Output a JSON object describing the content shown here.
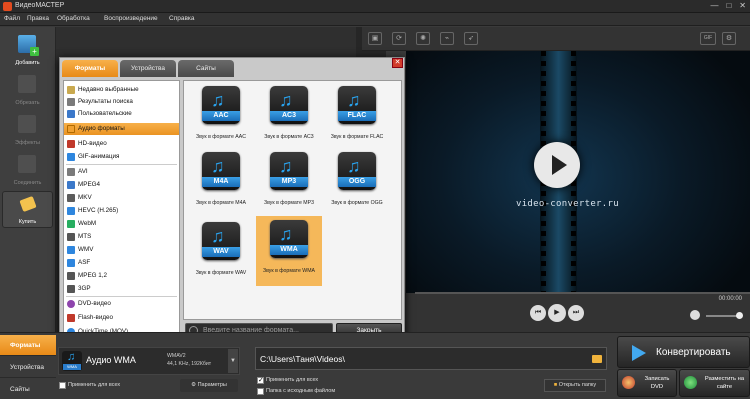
{
  "window": {
    "title": "ВидеоМАСТЕР",
    "controls": [
      "—",
      "□",
      "✕"
    ]
  },
  "menu": [
    "Файл",
    "Правка",
    "Обработка",
    "Воспроизведение",
    "Справка"
  ],
  "sidebar": [
    {
      "label": "Добавить",
      "icon": "add-video-icon",
      "enabled": true
    },
    {
      "label": "Обрезать",
      "icon": "cut-icon",
      "enabled": false
    },
    {
      "label": "Эффекты",
      "icon": "effects-icon",
      "enabled": false
    },
    {
      "label": "Соединить",
      "icon": "join-icon",
      "enabled": false
    },
    {
      "label": "Купить",
      "icon": "buy-icon",
      "enabled": true
    }
  ],
  "dialog": {
    "tabs": [
      "Форматы",
      "Устройства",
      "Сайты"
    ],
    "active_tab": "Форматы",
    "close": "✕",
    "categories": [
      {
        "label": "Недавно выбранные",
        "color": "#c9a94f"
      },
      {
        "label": "Результаты поиска",
        "color": "#7a7a7a"
      },
      {
        "label": "Пользовательские",
        "color": "#3b78c9"
      },
      {
        "label": "Аудио форматы",
        "color": "#f0a030",
        "selected": true
      },
      {
        "label": "HD-видео",
        "color": "#c0392b"
      },
      {
        "label": "GIF-анимация",
        "color": "#2e86de"
      },
      {
        "label": "AVI",
        "color": "#7a7a7a"
      },
      {
        "label": "MPEG4",
        "color": "#3b78c9"
      },
      {
        "label": "MKV",
        "color": "#5c5c5c"
      },
      {
        "label": "HEVC (H.265)",
        "color": "#2e86de"
      },
      {
        "label": "WebM",
        "color": "#27ae60"
      },
      {
        "label": "MTS",
        "color": "#555"
      },
      {
        "label": "WMV",
        "color": "#2e86de"
      },
      {
        "label": "ASF",
        "color": "#2e86de"
      },
      {
        "label": "MPEG 1,2",
        "color": "#555"
      },
      {
        "label": "3GP",
        "color": "#555"
      },
      {
        "label": "DVD-видео",
        "color": "#8e44ad"
      },
      {
        "label": "Flash-видео",
        "color": "#c0392b"
      },
      {
        "label": "QuickTime (MOV)",
        "color": "#2e86de"
      }
    ],
    "formats": [
      {
        "badge": "AAC",
        "caption": "Звук в формате AAC"
      },
      {
        "badge": "AC3",
        "caption": "Звук в формате AC3"
      },
      {
        "badge": "FLAC",
        "caption": "Звук в формате FLAC"
      },
      {
        "badge": "M4A",
        "caption": "Звук в формате M4A"
      },
      {
        "badge": "MP3",
        "caption": "Звук в формате MP3"
      },
      {
        "badge": "OGG",
        "caption": "Звук в формате OGG"
      },
      {
        "badge": "WAV",
        "caption": "Звук в формате WAV"
      },
      {
        "badge": "WMA",
        "caption": "Звук в формате WMA",
        "selected": true
      }
    ],
    "search_placeholder": "Введите название формата...",
    "close_label": "Закрыть"
  },
  "preview": {
    "watermark": "video-converter.ru",
    "time": "00:00:00",
    "toolbar_icons": [
      "crop-icon",
      "rotate-icon",
      "brightness-icon",
      "speed-icon",
      "run-icon"
    ],
    "right_toolbar": [
      "gif-icon",
      "settings-icon"
    ]
  },
  "bottom": {
    "tabs": [
      "Форматы",
      "Устройства",
      "Сайты"
    ],
    "active_tab": "Форматы",
    "format_name": "Аудио WMA",
    "format_codec": "WMAV2",
    "format_spec": "44,1 KHz, 192Кбит",
    "apply_all_label": "Применить для всех",
    "params_label": "Параметры",
    "path": "C:\\Users\\Таня\\Videos\\",
    "apply_all_path_label": "Применить для всех",
    "source_folder_label": "Папка с исходным файлом",
    "open_folder_label": "Открыть папку",
    "convert_label": "Конвертировать",
    "dvd_label": "Записать DVD",
    "site_label": "Разместить на сайте"
  }
}
